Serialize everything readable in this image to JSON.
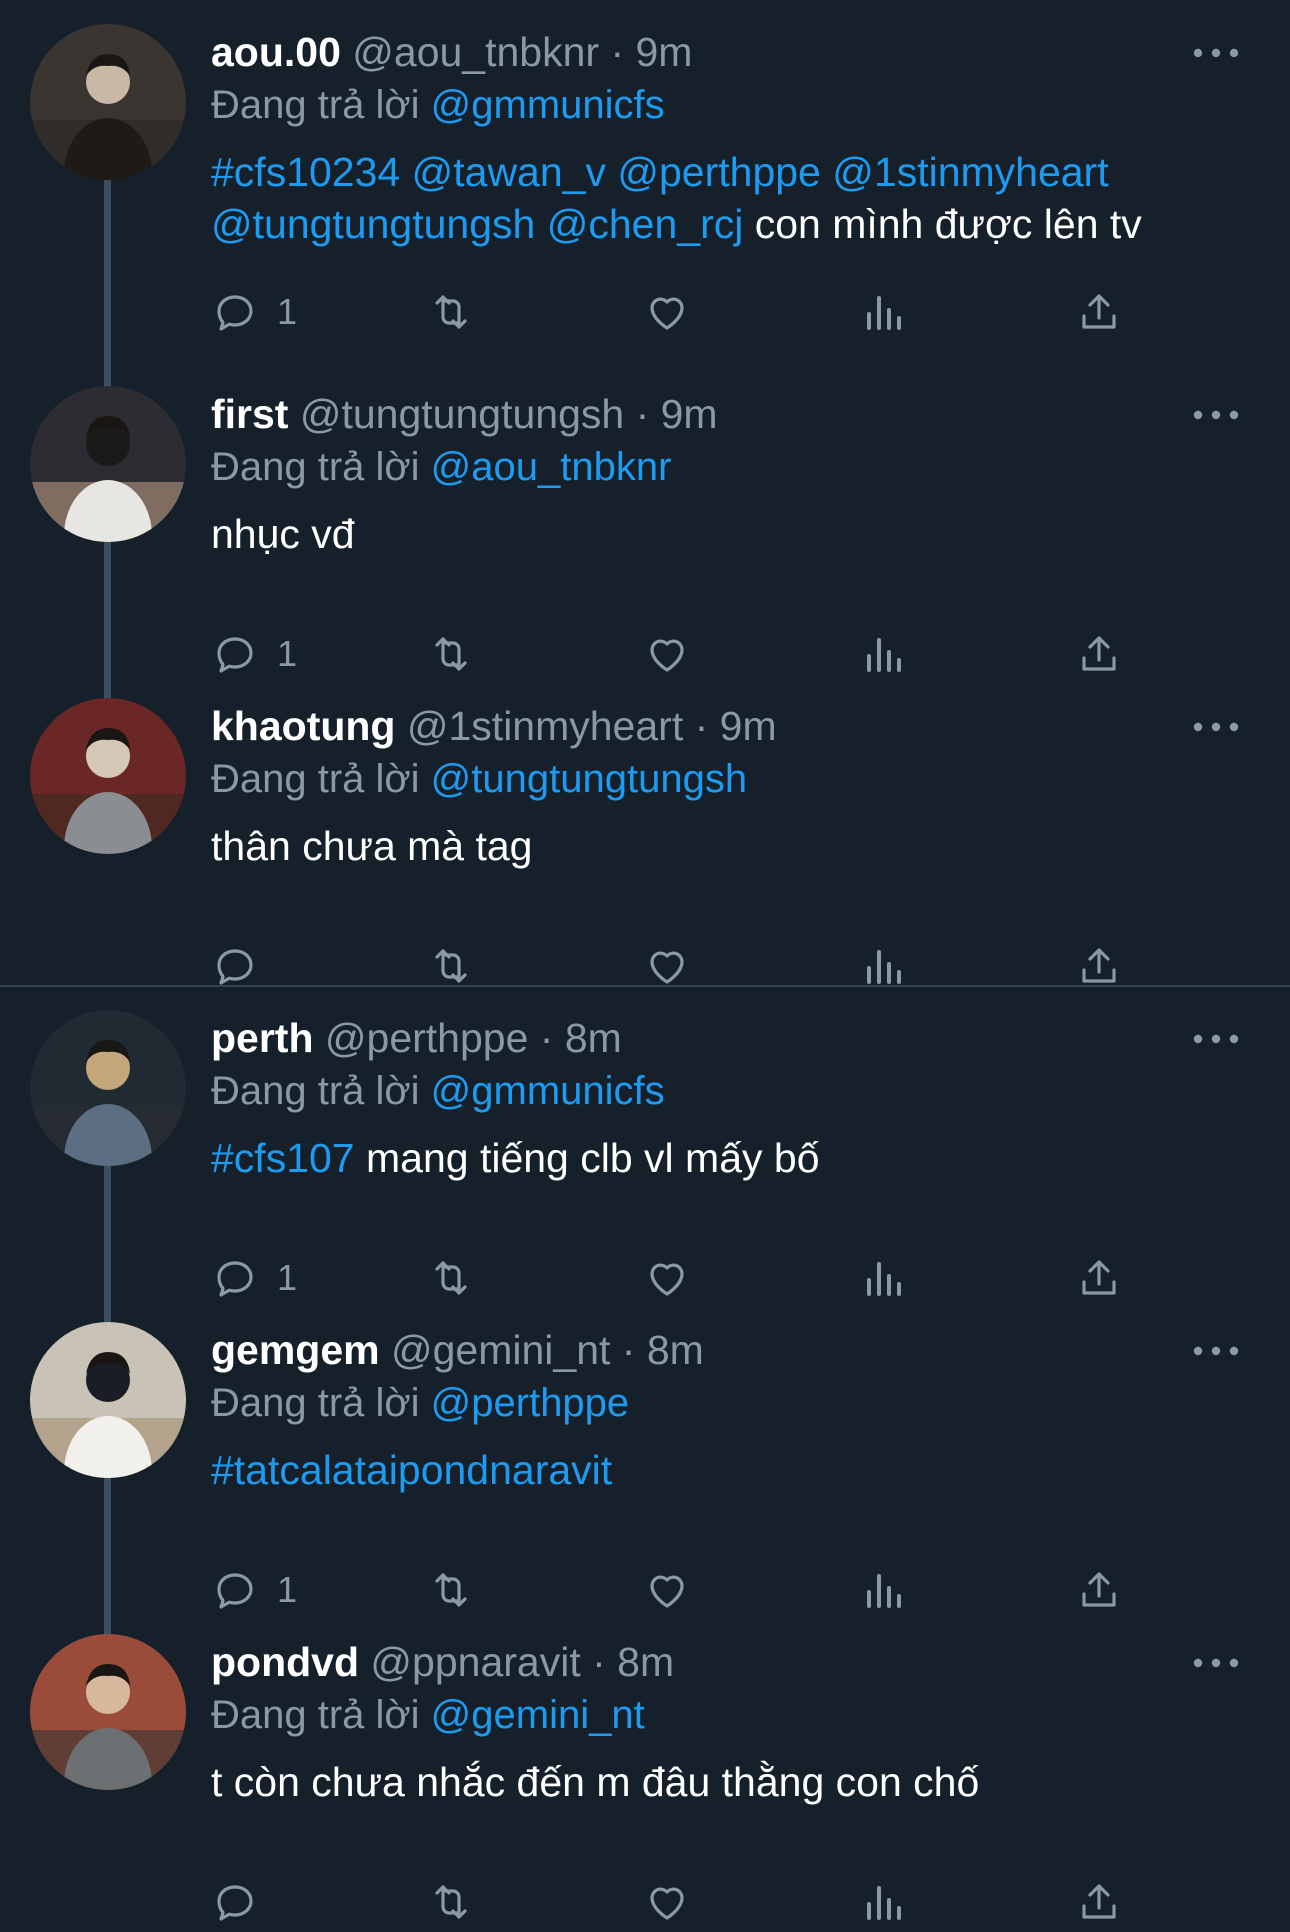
{
  "reply_prefix": "Đang trả lời",
  "colors": {
    "background": "#15202b",
    "primary_text": "#ffffff",
    "secondary_text": "#8b98a5",
    "link": "#1d9bf0",
    "thread_line": "#3d4e5e"
  },
  "tweets": [
    {
      "name": "aou.00",
      "handle": "@aou_tnbknr",
      "dot": "·",
      "time": "9m",
      "reply_to": "@gmmunicfs",
      "text_parts": [
        {
          "kind": "hashtag",
          "text": "#cfs10234"
        },
        {
          "kind": "plain",
          "text": " "
        },
        {
          "kind": "mention",
          "text": "@tawan_v"
        },
        {
          "kind": "plain",
          "text": " "
        },
        {
          "kind": "mention",
          "text": "@perthppe"
        },
        {
          "kind": "plain",
          "text": " "
        },
        {
          "kind": "mention",
          "text": "@1stinmyheart"
        },
        {
          "kind": "plain",
          "text": " "
        },
        {
          "kind": "mention",
          "text": "@tungtungtungsh"
        },
        {
          "kind": "plain",
          "text": " "
        },
        {
          "kind": "mention",
          "text": "@chen_rcj"
        },
        {
          "kind": "plain",
          "text": " con mình được lên tv"
        }
      ],
      "reply_count": "1",
      "avatar_icon": "avatar-photo"
    },
    {
      "name": "first",
      "handle": "@tungtungtungsh",
      "dot": "·",
      "time": "9m",
      "reply_to": "@aou_tnbknr",
      "text_parts": [
        {
          "kind": "plain",
          "text": "nhục vđ"
        }
      ],
      "reply_count": "1",
      "avatar_icon": "avatar-photo"
    },
    {
      "name": "khaotung",
      "handle": "@1stinmyheart",
      "dot": "·",
      "time": "9m",
      "reply_to": "@tungtungtungsh",
      "text_parts": [
        {
          "kind": "plain",
          "text": "thân chưa mà tag"
        }
      ],
      "reply_count": "",
      "avatar_icon": "avatar-photo"
    },
    {
      "name": "perth",
      "handle": "@perthppe",
      "dot": "·",
      "time": "8m",
      "reply_to": "@gmmunicfs",
      "text_parts": [
        {
          "kind": "hashtag",
          "text": "#cfs107"
        },
        {
          "kind": "plain",
          "text": " mang tiếng clb vl mấy bố"
        }
      ],
      "reply_count": "1",
      "avatar_icon": "avatar-photo"
    },
    {
      "name": "gemgem",
      "handle": "@gemini_nt",
      "dot": "·",
      "time": "8m",
      "reply_to": "@perthppe",
      "text_parts": [
        {
          "kind": "hashtag",
          "text": "#tatcalataipondnaravit"
        }
      ],
      "reply_count": "1",
      "avatar_icon": "avatar-photo"
    },
    {
      "name": "pondvd",
      "handle": "@ppnaravit",
      "dot": "·",
      "time": "8m",
      "reply_to": "@gemini_nt",
      "text_parts": [
        {
          "kind": "plain",
          "text": "t còn chưa nhắc đến m đâu thằng con chố"
        }
      ],
      "reply_count": "",
      "avatar_icon": "avatar-photo"
    }
  ]
}
